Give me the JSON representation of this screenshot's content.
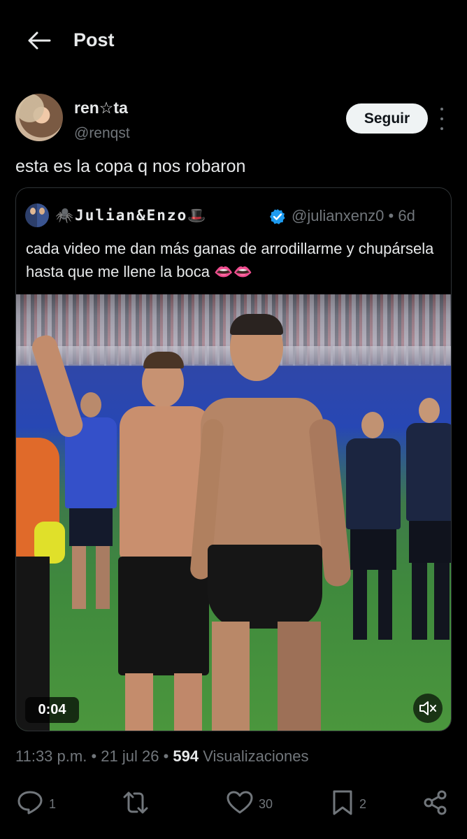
{
  "header": {
    "title": "Post"
  },
  "post": {
    "author_name": "ren☆ta",
    "author_handle": "@renqst",
    "follow_label": "Seguir",
    "text": "esta es la copa q nos robaron"
  },
  "quoted": {
    "author_name": "🕷️Julian&Enzo🎩",
    "handle_time": "@julianxenz0 • 6d",
    "text": "cada video me dan más ganas de arrodillarme y chupársela hasta que me llene la boca 👄👄",
    "video_duration": "0:04"
  },
  "meta": {
    "time": "11:33 p.m.",
    "date": "21 jul 26",
    "views_count": "594",
    "views_label": "Visualizaciones"
  },
  "actions": {
    "replies": "1",
    "reposts": "",
    "likes": "30",
    "bookmarks": "2"
  },
  "colors": {
    "background": "#000000",
    "text": "#e7e9ea",
    "muted": "#71767b",
    "verified": "#1d9bf0"
  }
}
